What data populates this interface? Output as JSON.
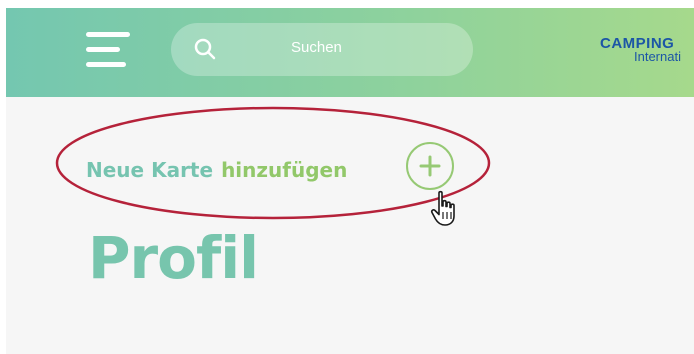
{
  "header": {
    "search_placeholder": "Suchen",
    "brand_line1": "CAMPING",
    "brand_line2": "Internati"
  },
  "add_card": {
    "label_part1": "Neue Karte",
    "label_part2": "hinzufügen"
  },
  "page": {
    "title": "Profil"
  },
  "icons": {
    "menu": "hamburger-icon",
    "search": "search-icon",
    "add": "plus-icon",
    "pointer": "hand-cursor-icon"
  },
  "colors": {
    "header_start": "#74c7b0",
    "header_end": "#a6d98c",
    "teal_text": "#76c4b0",
    "green_text": "#92c86a",
    "brand_blue": "#1c56a6",
    "annotation_red": "#b5223a"
  }
}
